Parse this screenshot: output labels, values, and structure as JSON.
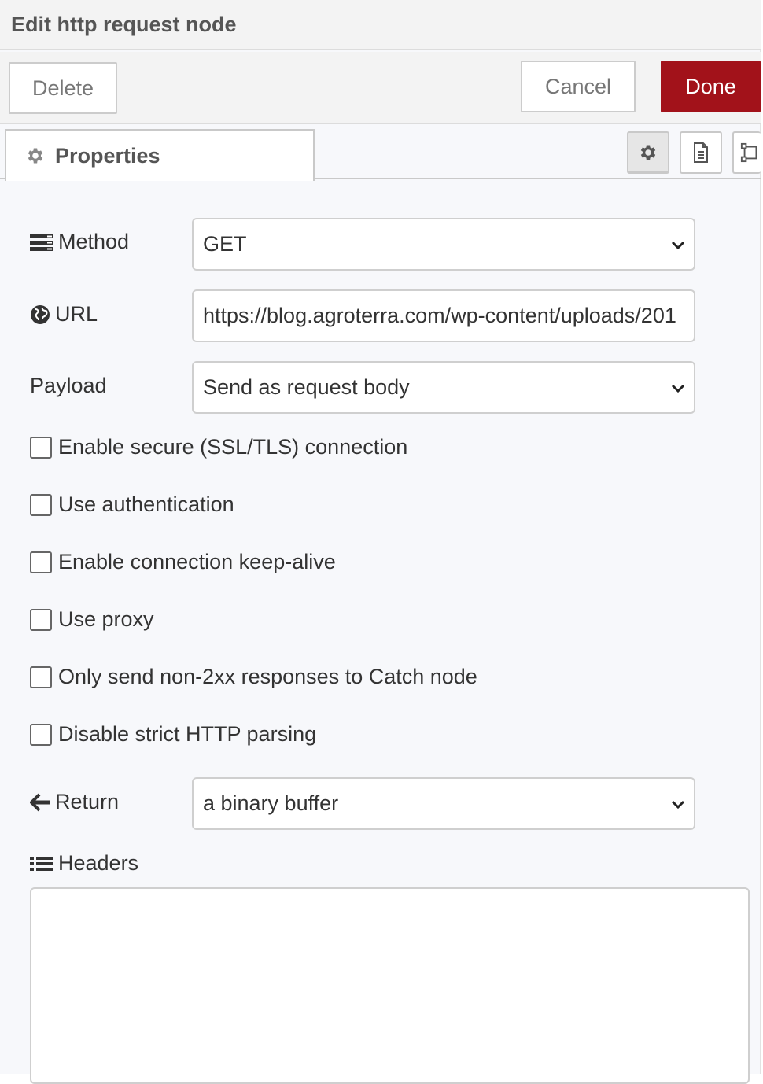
{
  "header": {
    "title": "Edit http request node"
  },
  "toolbar": {
    "delete_label": "Delete",
    "cancel_label": "Cancel",
    "done_label": "Done"
  },
  "tabs": {
    "properties_label": "Properties"
  },
  "form": {
    "method": {
      "label": "Method",
      "value": "GET"
    },
    "url": {
      "label": "URL",
      "value": "https://blog.agroterra.com/wp-content/uploads/201"
    },
    "payload": {
      "label": "Payload",
      "value": "Send as request body"
    },
    "checkboxes": [
      {
        "label": "Enable secure (SSL/TLS) connection",
        "checked": false
      },
      {
        "label": "Use authentication",
        "checked": false
      },
      {
        "label": "Enable connection keep-alive",
        "checked": false
      },
      {
        "label": "Use proxy",
        "checked": false
      },
      {
        "label": "Only send non-2xx responses to Catch node",
        "checked": false
      },
      {
        "label": "Disable strict HTTP parsing",
        "checked": false
      }
    ],
    "return": {
      "label": "Return",
      "value": "a binary buffer"
    },
    "headers": {
      "label": "Headers"
    }
  },
  "colors": {
    "done_button": "#a2121a",
    "tray_background": "#f7f8fb"
  },
  "icons": [
    "gear-icon",
    "description-icon",
    "appearance-icon",
    "list-icon",
    "globe-icon",
    "arrow-left-icon",
    "chevron-down-icon"
  ]
}
